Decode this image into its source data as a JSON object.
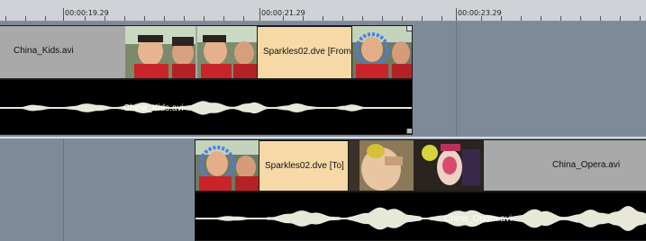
{
  "ruler": {
    "timecodes": [
      "00:00:19.29",
      "00:00:21.29",
      "00:00:23.29"
    ]
  },
  "track1": {
    "video_clip_name": "China_Kids.avi",
    "transition_label": "Sparkles02.dve  [From]",
    "audio_clip_name": "China_Kids.avi"
  },
  "track2": {
    "transition_label": "Sparkles02.dve  [To]",
    "video_clip_name": "China_Opera.avi",
    "audio_clip_name": "China_Opera.avi"
  },
  "colors": {
    "timeline_bg": "#7f8a99",
    "clip_grey": "#a9a9a9",
    "transition_peach": "#f6d9a6",
    "audio_black": "#000000",
    "waveform": "#e8e8d8"
  }
}
